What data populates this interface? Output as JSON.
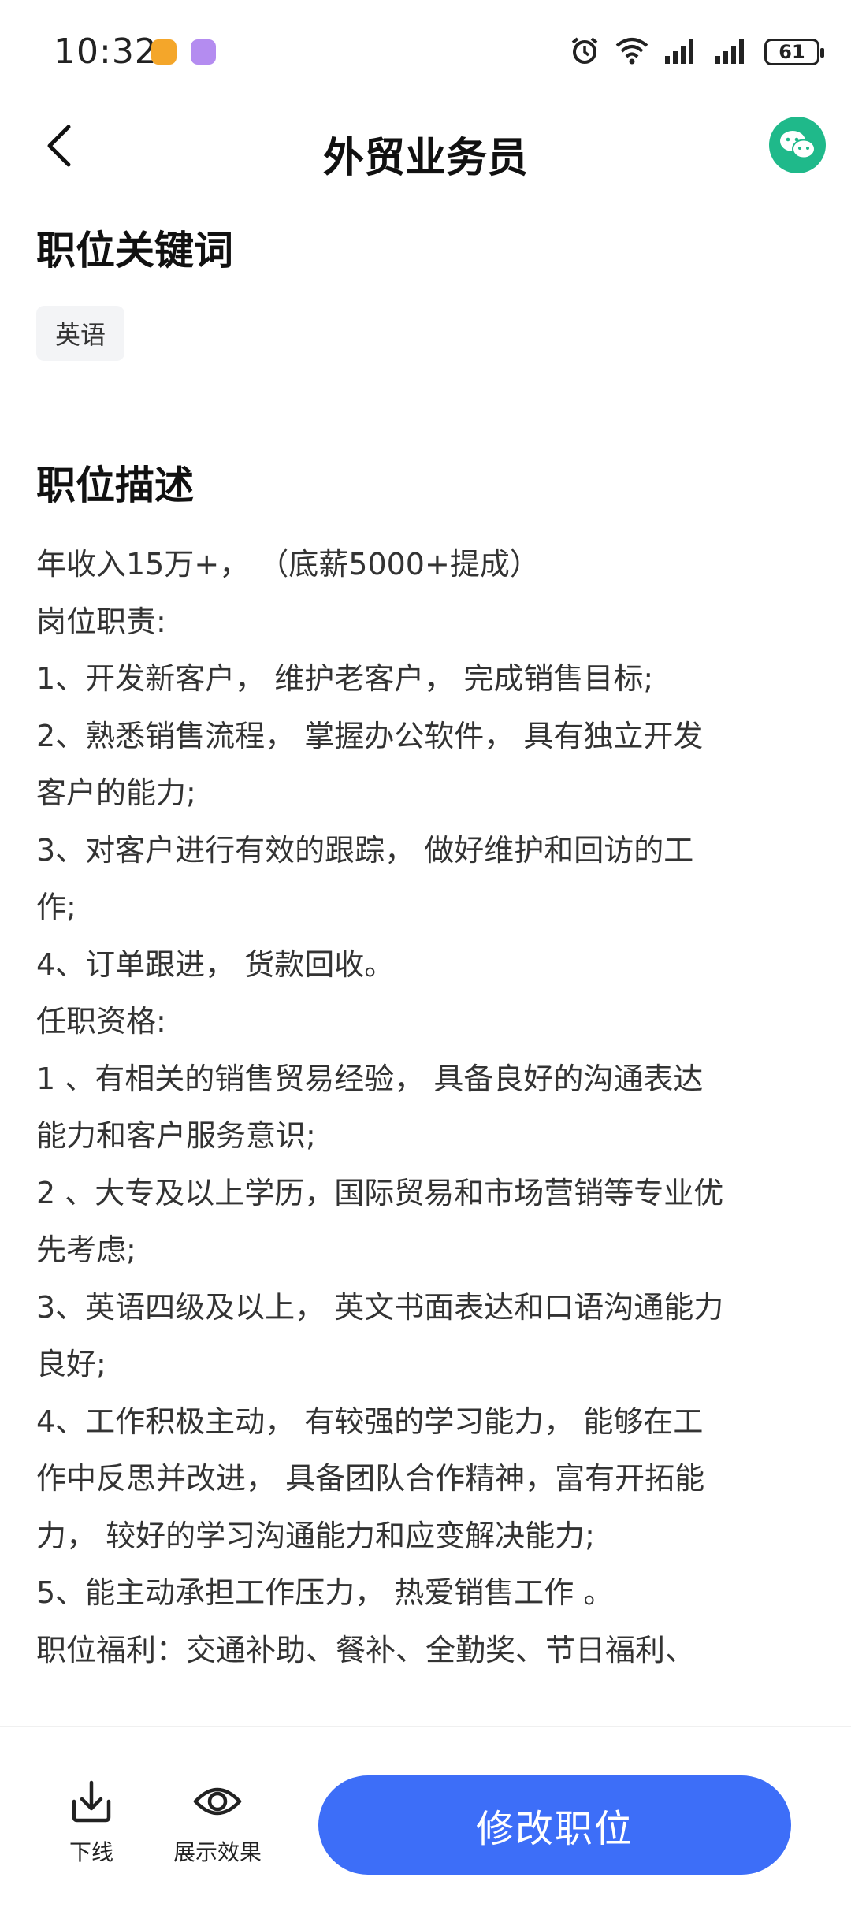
{
  "status_bar": {
    "time": "10:32",
    "battery": "61"
  },
  "header": {
    "title": "外贸业务员"
  },
  "keywords": {
    "title": "职位关键词",
    "tags": [
      "英语"
    ]
  },
  "description": {
    "title": "职位描述",
    "lines": [
      "年收入15万+， （底薪5000+提成）",
      "岗位职责:",
      "1、开发新客户， 维护老客户， 完成销售目标;",
      "2、熟悉销售流程， 掌握办公软件， 具有独立开发",
      "客户的能力;",
      "3、对客户进行有效的跟踪， 做好维护和回访的工",
      "作;",
      "4、订单跟进， 货款回收。",
      "任职资格:",
      "1 、有相关的销售贸易经验， 具备良好的沟通表达",
      "能力和客户服务意识;",
      "2 、大专及以上学历，国际贸易和市场营销等专业优",
      "先考虑;",
      "3、英语四级及以上， 英文书面表达和口语沟通能力",
      "良好;",
      "4、工作积极主动， 有较强的学习能力， 能够在工",
      "作中反思并改进， 具备团队合作精神，富有开拓能",
      "力， 较好的学习沟通能力和应变解决能力;",
      "5、能主动承担工作压力， 热爱销售工作 。",
      "职位福利：交通补助、餐补、全勤奖、节日福利、"
    ]
  },
  "bottom_bar": {
    "offline_label": "下线",
    "preview_label": "展示效果",
    "edit_button": "修改职位"
  },
  "colors": {
    "primary": "#3d6ef8",
    "wechat": "#1fb98a",
    "tag_bg": "#f3f4f6"
  },
  "icons": [
    "back-arrow-icon",
    "wechat-icon",
    "download-icon",
    "eye-icon",
    "alarm-icon",
    "wifi-icon",
    "signal-icon",
    "battery-icon"
  ]
}
